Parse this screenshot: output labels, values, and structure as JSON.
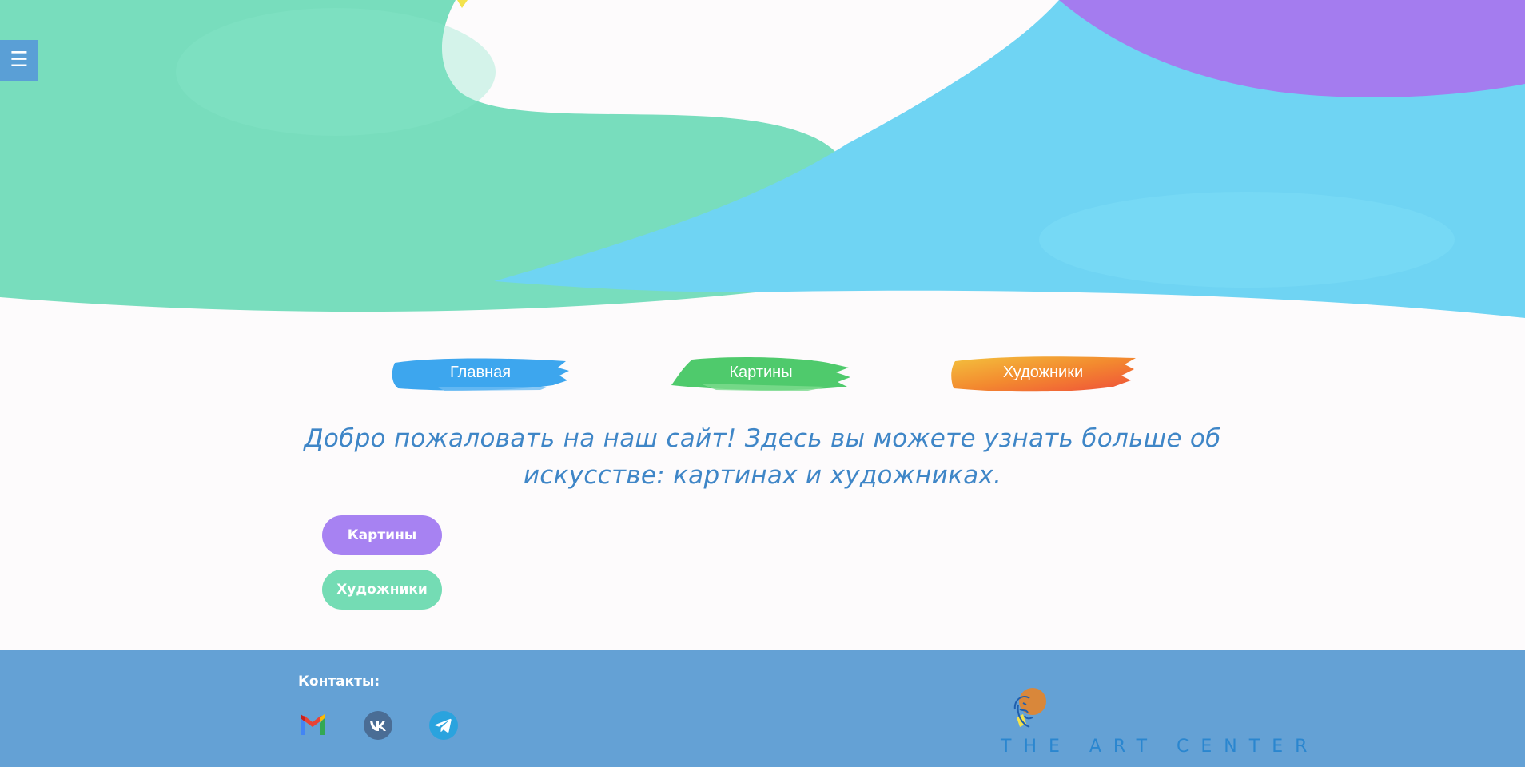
{
  "header": {
    "menu_icon": "☰"
  },
  "nav": {
    "items": [
      {
        "label": "Главная",
        "color": "#3da6ee"
      },
      {
        "label": "Картины",
        "color": "#4fca6c"
      },
      {
        "label": "Художники",
        "color": "#f08a2f"
      }
    ]
  },
  "main": {
    "welcome_text": "Добро пожаловать на наш сайт! Здесь вы можете узнать больше об искусстве: картинах и художниках.",
    "buttons": {
      "paintings": "Картины",
      "artists": "Художники"
    }
  },
  "footer": {
    "contacts_label": "Контакты:",
    "social": [
      "gmail-icon",
      "vk-icon",
      "telegram-icon"
    ],
    "logo_text": "THE ART CENTER"
  },
  "colors": {
    "accent_blue": "#64a1d5",
    "welcome_text": "#3f86c7",
    "purple_button": "#a782f2",
    "green_button": "#74dcb4"
  }
}
